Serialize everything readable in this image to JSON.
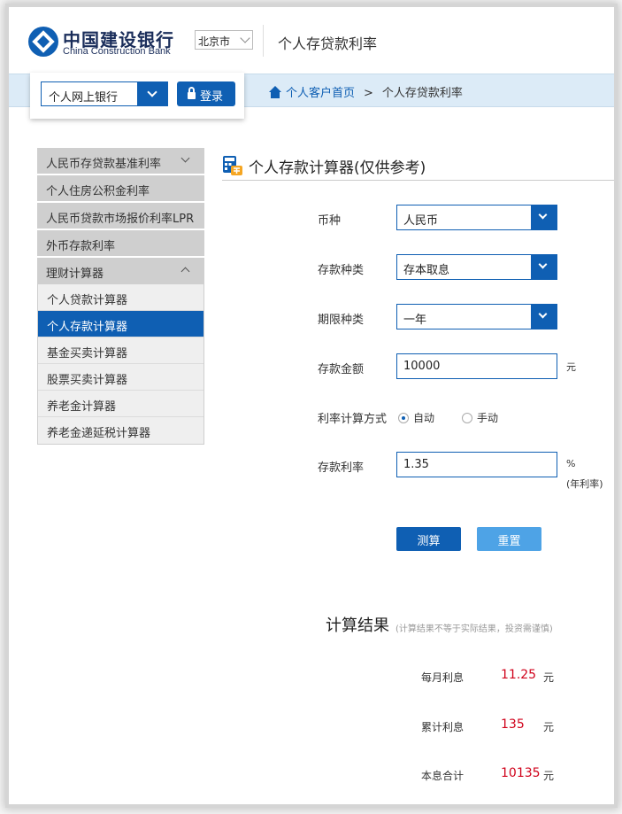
{
  "header": {
    "bank_name_cn": "中国建设银行",
    "bank_name_en": "China Construction Bank",
    "city": "北京市",
    "page_title": "个人存贷款利率"
  },
  "login": {
    "bank_option": "个人网上银行",
    "login_label": "登录"
  },
  "breadcrumb": {
    "home": "个人客户首页",
    "separator": ">",
    "current": "个人存贷款利率"
  },
  "sidebar": {
    "groups": [
      {
        "label": "人民币存贷款基准利率"
      },
      {
        "label": "个人住房公积金利率"
      },
      {
        "label": "人民币贷款市场报价利率LPR"
      },
      {
        "label": "外币存款利率"
      },
      {
        "label": "理财计算器"
      }
    ],
    "sub_items": [
      {
        "label": "个人贷款计算器"
      },
      {
        "label": "个人存款计算器"
      },
      {
        "label": "基金买卖计算器"
      },
      {
        "label": "股票买卖计算器"
      },
      {
        "label": "养老金计算器"
      },
      {
        "label": "养老金递延税计算器"
      }
    ]
  },
  "calculator": {
    "title": "个人存款计算器(仅供参考)",
    "currency_label": "币种",
    "currency_value": "人民币",
    "deposit_type_label": "存款种类",
    "deposit_type_value": "存本取息",
    "term_label": "期限种类",
    "term_value": "一年",
    "amount_label": "存款金额",
    "amount_value": "10000",
    "amount_unit": "元",
    "rate_method_label": "利率计算方式",
    "rate_method_auto": "自动",
    "rate_method_manual": "手动",
    "rate_label": "存款利率",
    "rate_value": "1.35",
    "rate_unit": "%",
    "rate_unit_note": "(年利率)",
    "calc_button": "测算",
    "reset_button": "重置"
  },
  "result": {
    "title": "计算结果",
    "note": "(计算结果不等于实际结果，投资需谨慎)",
    "monthly_label": "每月利息",
    "monthly_value": "11.25",
    "total_interest_label": "累计利息",
    "total_interest_value": "135",
    "sum_label": "本息合计",
    "sum_value": "10135",
    "unit": "元"
  },
  "colors": {
    "brand_blue": "#0f5fb3",
    "reset_blue": "#4ea3e6",
    "result_red": "#d0021b"
  }
}
